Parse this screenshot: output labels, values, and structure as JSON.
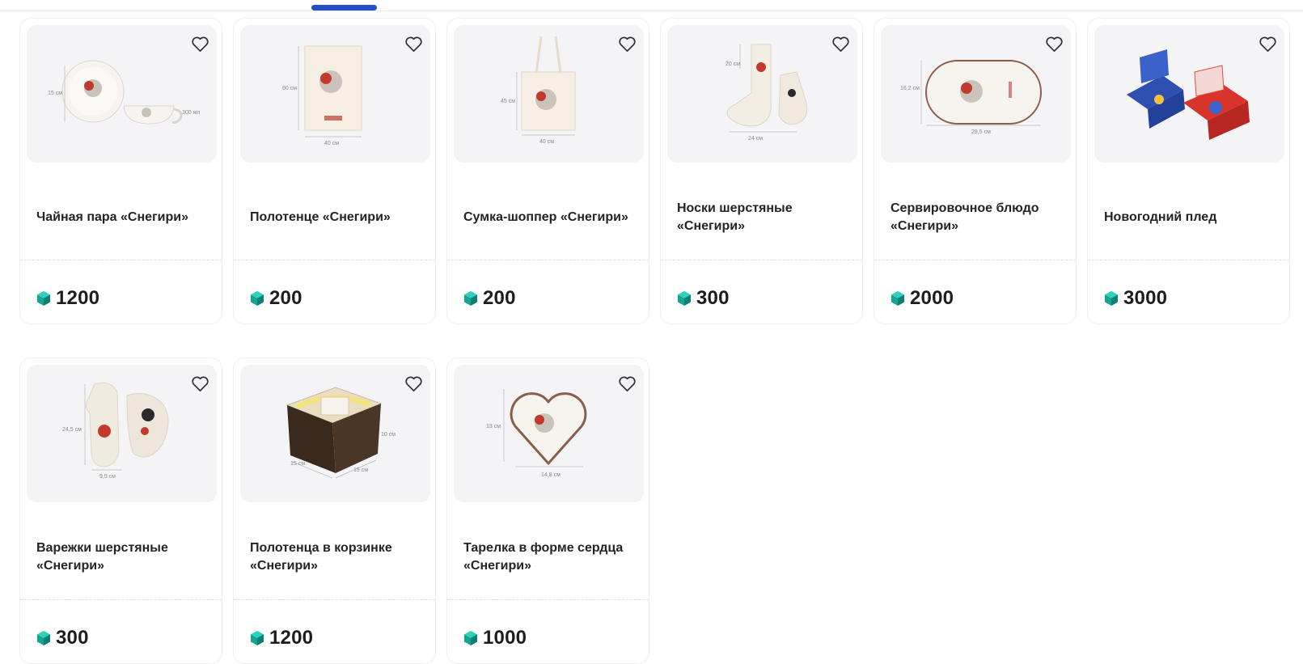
{
  "products": [
    {
      "name": "Чайная пара «Снегири»",
      "price": "1200",
      "dims": [
        "15 см",
        "300 мл"
      ]
    },
    {
      "name": "Полотенце «Снегири»",
      "price": "200",
      "dims": [
        "60 см",
        "40 см"
      ]
    },
    {
      "name": "Сумка-шоппер «Снегири»",
      "price": "200",
      "dims": [
        "45 см",
        "40 см"
      ]
    },
    {
      "name": "Носки шерстяные «Снегири»",
      "price": "300",
      "dims": [
        "20 см",
        "24 см"
      ]
    },
    {
      "name": "Сервировочное блюдо «Снегири»",
      "price": "2000",
      "dims": [
        "16,2 см",
        "29,5 см"
      ]
    },
    {
      "name": "Новогодний плед",
      "price": "3000",
      "dims": []
    },
    {
      "name": "Варежки шерстяные «Снегири»",
      "price": "300",
      "dims": [
        "24,5 см",
        "9,5 см"
      ]
    },
    {
      "name": "Полотенца в корзинке «Снегири»",
      "price": "1200",
      "dims": [
        "10 см",
        "15 см",
        "15 см"
      ]
    },
    {
      "name": "Тарелка в форме сердца «Снегири»",
      "price": "1000",
      "dims": [
        "13 см",
        "14,8 см"
      ]
    }
  ],
  "icons": {
    "favorite": "heart-outline-icon",
    "currency": "gem-icon"
  },
  "colors": {
    "accent": "#2350c7",
    "gem": "#16a89a"
  }
}
